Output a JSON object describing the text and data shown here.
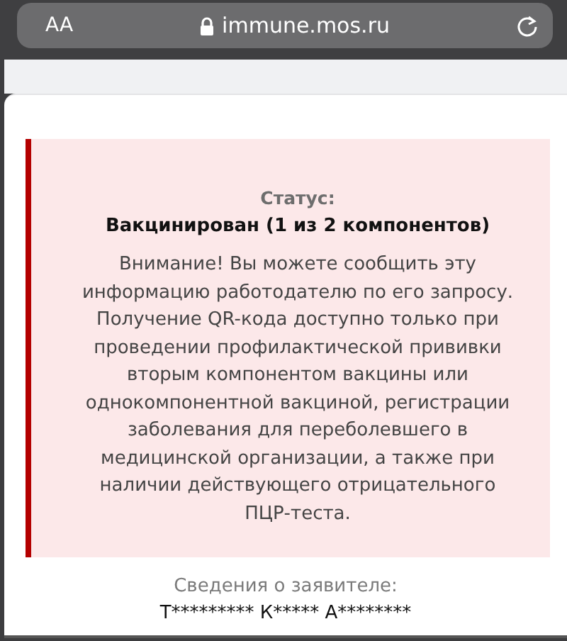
{
  "browser": {
    "text_size_button": "AA",
    "url": "immune.mos.ru"
  },
  "status": {
    "label": "Статус:",
    "value": "Вакцинирован (1 из 2 компонентов)",
    "notice": "Внимание! Вы можете сообщить эту\nинформацию работодателю по его запросу.\nПолучение QR-кода доступно только при\nпроведении профилактической прививки\nвторым компонентом вакцины или\nоднокомпонентной вакциной, регистрации\nзаболевания для переболевшего в\nмедицинской организации, а также при\nналичии действующего отрицательного\nПЦР-теста."
  },
  "applicant": {
    "label": "Сведения о заявителе:",
    "name": "Т********* К***** А********"
  }
}
